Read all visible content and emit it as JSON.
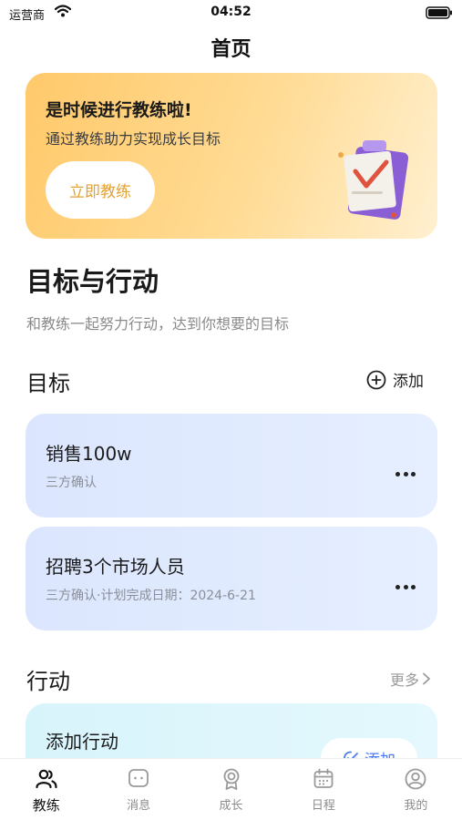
{
  "status_bar": {
    "carrier": "运营商",
    "time": "04:52"
  },
  "header": {
    "title": "首页"
  },
  "banner": {
    "title": "是时候进行教练啦!",
    "subtitle": "通过教练助力实现成长目标",
    "button_label": "立即教练",
    "accent": "#e2a233"
  },
  "intro": {
    "title": "目标与行动",
    "subtitle": "和教练一起努力行动，达到你想要的目标"
  },
  "goals": {
    "header": "目标",
    "add_label": "添加",
    "items": [
      {
        "title": "销售100w",
        "meta": "三方确认"
      },
      {
        "title": "招聘3个市场人员",
        "meta": "三方确认·计划完成日期：2024-6-21"
      }
    ]
  },
  "actions": {
    "header": "行动",
    "more_label": "更多",
    "card_title": "添加行动",
    "add_label": "添加"
  },
  "tabs": [
    {
      "label": "教练",
      "icon": "people-icon",
      "active": true
    },
    {
      "label": "消息",
      "icon": "message-icon",
      "active": false
    },
    {
      "label": "成长",
      "icon": "medal-icon",
      "active": false
    },
    {
      "label": "日程",
      "icon": "calendar-icon",
      "active": false
    },
    {
      "label": "我的",
      "icon": "profile-icon",
      "active": false
    }
  ]
}
